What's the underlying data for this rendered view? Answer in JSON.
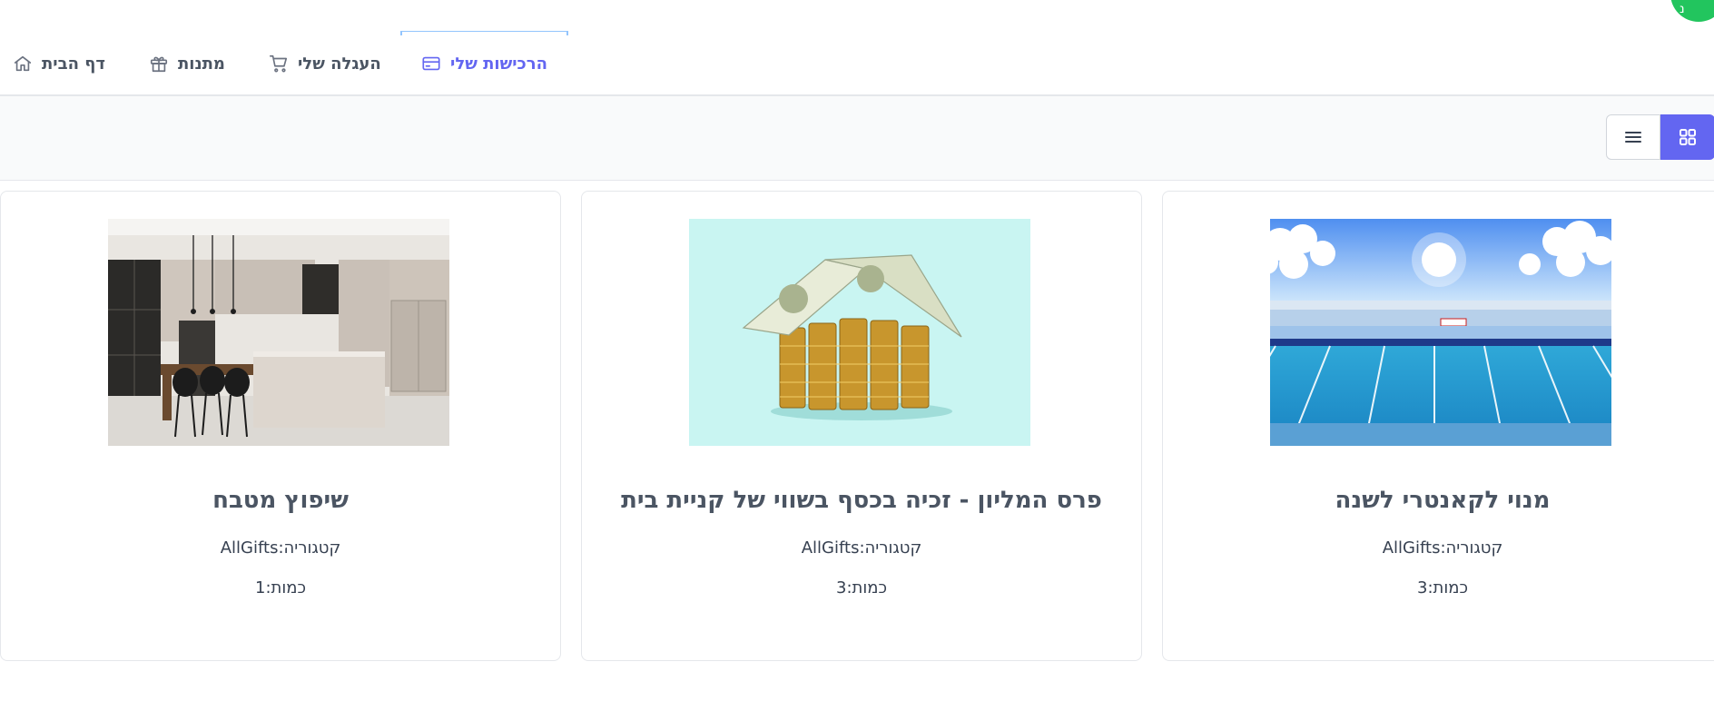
{
  "avatar": {
    "initial": "נ"
  },
  "tabs": [
    {
      "label": "הרכישות שלי",
      "icon": "credit-card-icon",
      "active": true
    },
    {
      "label": "העגלה שלי",
      "icon": "cart-icon",
      "active": false
    },
    {
      "label": "מתנות",
      "icon": "gift-icon",
      "active": false
    },
    {
      "label": "דף הבית",
      "icon": "home-icon",
      "active": false
    }
  ],
  "view_toggle": {
    "active": "grid",
    "options": [
      "grid-icon",
      "list-icon"
    ]
  },
  "colors": {
    "accent": "#6366f1",
    "avatar": "#22c55e"
  },
  "cards": [
    {
      "title": "מנוי לקאנטרי לשנה",
      "category_label": "קטגוריה:",
      "category": "AllGifts",
      "quantity_label": "כמות:",
      "quantity": "3",
      "image": "swimming-pool-photo"
    },
    {
      "title": "פרס המליון - זכיה בכסף בשווי של קניית בית",
      "category_label": "קטגוריה:",
      "category": "AllGifts",
      "quantity_label": "כמות:",
      "quantity": "3",
      "image": "money-house-photo"
    },
    {
      "title": "שיפוץ מטבח",
      "category_label": "קטגוריה:",
      "category": "AllGifts",
      "quantity_label": "כמות:",
      "quantity": "1",
      "image": "kitchen-photo"
    }
  ]
}
